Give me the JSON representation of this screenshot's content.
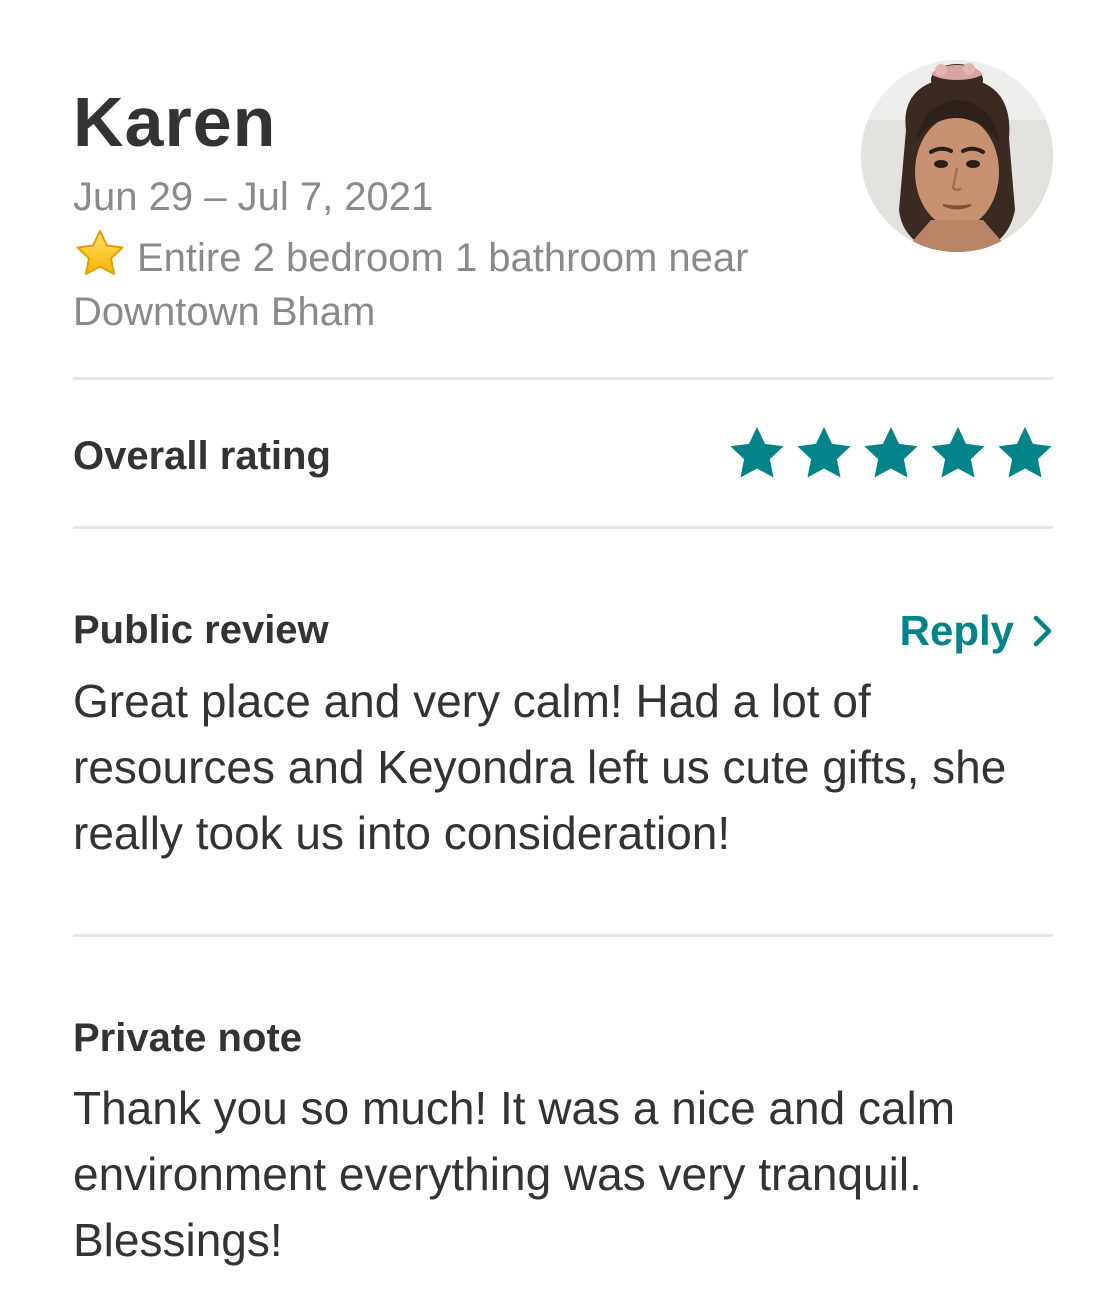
{
  "guest": {
    "name": "Karen",
    "stay_dates": "Jun 29 – Jul 7, 2021",
    "listing_emoji": "star-emoji",
    "listing_title": "Entire 2 bedroom 1 bathroom near Downtown Bham",
    "avatar_icon": "guest-avatar-photo"
  },
  "rating": {
    "label": "Overall rating",
    "stars": 5,
    "max_stars": 5,
    "color": "#008489"
  },
  "public_review": {
    "title": "Public review",
    "reply_label": "Reply",
    "reply_icon": "chevron-right-icon",
    "text": "Great place and very calm! Had a lot of resources and Keyondra left us cute gifts, she really took us into consideration!"
  },
  "private_note": {
    "title": "Private note",
    "text": "Thank you so much! It was a nice and calm environment everything was very tranquil. Blessings!"
  },
  "colors": {
    "accent": "#008489",
    "text_primary": "#333333",
    "text_secondary": "#8a8a8a",
    "divider": "#e6e6e6"
  }
}
